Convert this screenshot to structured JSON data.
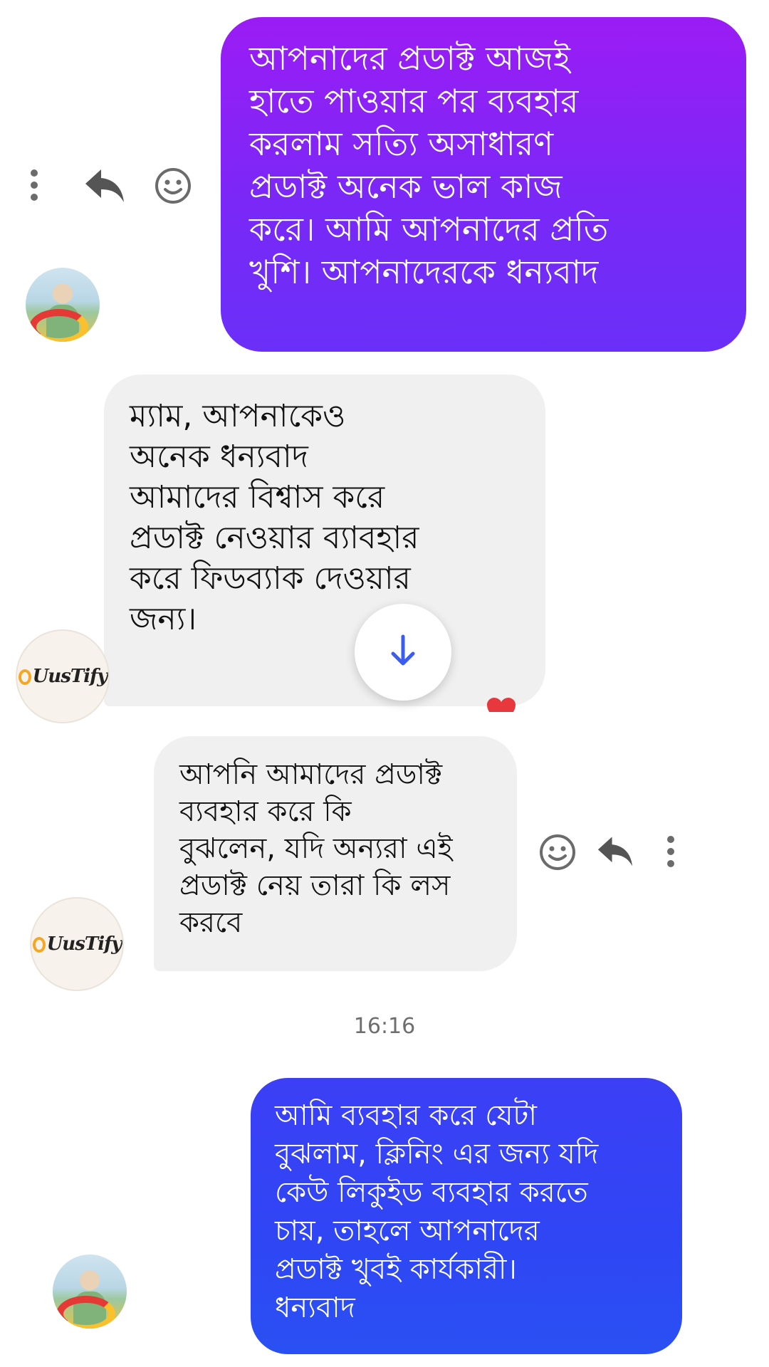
{
  "messages": [
    {
      "id": "m1",
      "direction": "outgoing",
      "text": "আপনাদের প্রডাক্ট আজই\nহাতে পাওয়ার পর ব্যবহার\nকরলাম সত্যি অসাধারণ\nপ্রডাক্ট অনেক ভাল কাজ\nকরে। আমি আপনাদের প্রতি\nখুশি। আপনাদেরকে ধন্যবাদ"
    },
    {
      "id": "m2",
      "direction": "incoming",
      "text": "ম্যাম, আপনাকেও\nঅনেক ধন্যবাদ\nআমাদের বিশ্বাস করে\nপ্রডাক্ট নেওয়ার ব্যাবহার\nকরে ফিডব্যাক দেওয়ার\nজন্য।",
      "reaction": "heart"
    },
    {
      "id": "m3",
      "direction": "incoming",
      "text": "আপনি আমাদের প্রডাক্ট\nব্যবহার করে কি\nবুঝলেন, যদি অন্যরা এই\nপ্রডাক্ট নেয় তারা কি লস\nকরবে"
    },
    {
      "id": "m4",
      "direction": "outgoing",
      "text": "আমি ব্যবহার করে যেটা\nবুঝলাম, ক্লিনিং এর জন্য যদি\nকেউ লিকুইড ব্যবহার করতে\nচায়, তাহলে আপনাদের\nপ্রডাক্ট খুবই কার্যকারী।\nধন্যবাদ"
    }
  ],
  "timestamp": "16:16",
  "brand": {
    "name": "UusTify"
  },
  "colors": {
    "outgoing_top": "#9b1cf5",
    "outgoing_mid": "#6a2ff8",
    "outgoing_bottom": "#2f46f5",
    "incoming_bg": "#f0f0f0",
    "icon_gray": "#6b6b6b",
    "scroll_arrow": "#3b5cf0",
    "heart": "#e8383d"
  },
  "icons": {
    "more": "more-vertical-icon",
    "reply": "reply-icon",
    "react": "smiley-icon",
    "scroll": "arrow-down-icon",
    "reaction": "heart-icon"
  }
}
